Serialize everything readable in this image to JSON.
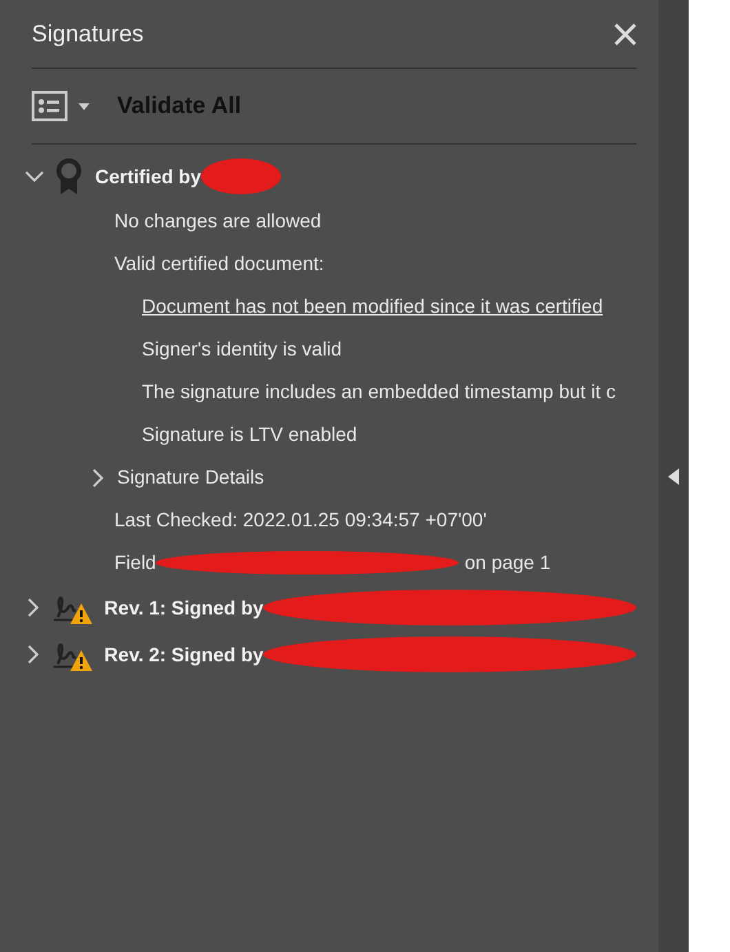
{
  "panel": {
    "title": "Signatures"
  },
  "toolbar": {
    "button": "Validate All"
  },
  "signatures": [
    {
      "kind": "certified",
      "label": "Certified by",
      "expanded": true,
      "details": [
        {
          "kind": "text",
          "text": "No changes are allowed"
        },
        {
          "kind": "text",
          "text": "Valid certified document:",
          "children": [
            {
              "kind": "link",
              "text": "Document has not been modified since it was certified"
            },
            {
              "kind": "text",
              "text": "Signer's identity is valid"
            },
            {
              "kind": "text",
              "text": "The signature includes an embedded timestamp but it c"
            },
            {
              "kind": "text",
              "text": "Signature is LTV enabled"
            }
          ]
        },
        {
          "kind": "expander",
          "text": "Signature Details",
          "expanded": false
        },
        {
          "kind": "text",
          "text": "Last Checked: 2022.01.25 09:34:57 +07'00'"
        },
        {
          "kind": "field",
          "text": "Field",
          "suffix": "on page 1"
        }
      ]
    },
    {
      "kind": "warning",
      "label": "Rev. 1: Signed by",
      "expanded": false
    },
    {
      "kind": "warning",
      "label": "Rev. 2: Signed by",
      "expanded": false
    }
  ]
}
